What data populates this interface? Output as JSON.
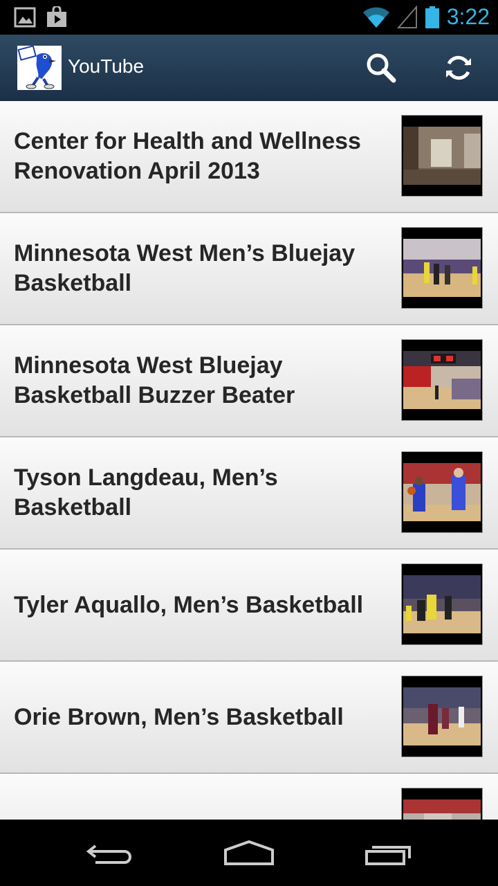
{
  "status_bar": {
    "time": "3:22"
  },
  "action_bar": {
    "title": "YouTube"
  },
  "videos": [
    {
      "title": "Center for Health and Wellness Renovation April 2013"
    },
    {
      "title": "Minnesota West Men’s Bluejay Basketball"
    },
    {
      "title": "Minnesota West Bluejay Basketball Buzzer Beater"
    },
    {
      "title": "Tyson Langdeau, Men’s Basketball"
    },
    {
      "title": "Tyler Aquallo, Men’s Basketball"
    },
    {
      "title": "Orie Brown, Men’s Basketball"
    },
    {
      "title": ""
    }
  ],
  "colors": {
    "accent": "#33b5e5",
    "actionbar": "#243b54"
  }
}
